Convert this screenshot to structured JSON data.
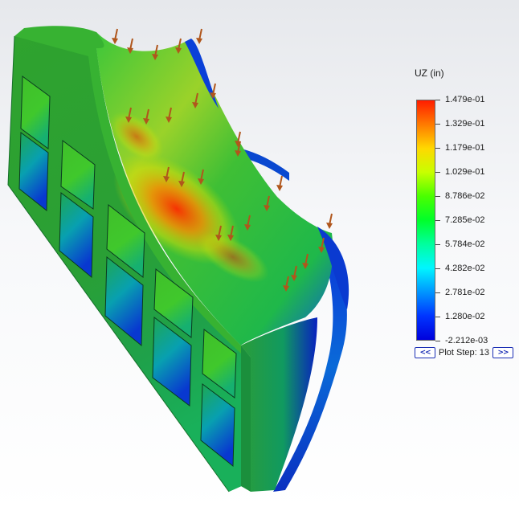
{
  "legend": {
    "title": "UZ (in)",
    "ticks": [
      "1.479e-01",
      "1.329e-01",
      "1.179e-01",
      "1.029e-01",
      "8.786e-02",
      "7.285e-02",
      "5.784e-02",
      "4.282e-02",
      "2.781e-02",
      "1.280e-02",
      "-2.212e-03"
    ],
    "colors": [
      "#ff1d00",
      "#ff7a00",
      "#ffd800",
      "#c8ff00",
      "#4aff00",
      "#00ff2a",
      "#00ff9e",
      "#00f6ff",
      "#0096ff",
      "#0035ff",
      "#0000dc"
    ],
    "plot_step_label": "Plot Step: 13",
    "prev_button": "<<",
    "next_button": ">>"
  },
  "model": {
    "load_arrow_icon": "load-arrow-icon",
    "body_color": "#3fbf3a",
    "peak_color": "#ff3a00",
    "low_color": "#0022d0",
    "load_arrow_color": "#b0561c"
  }
}
